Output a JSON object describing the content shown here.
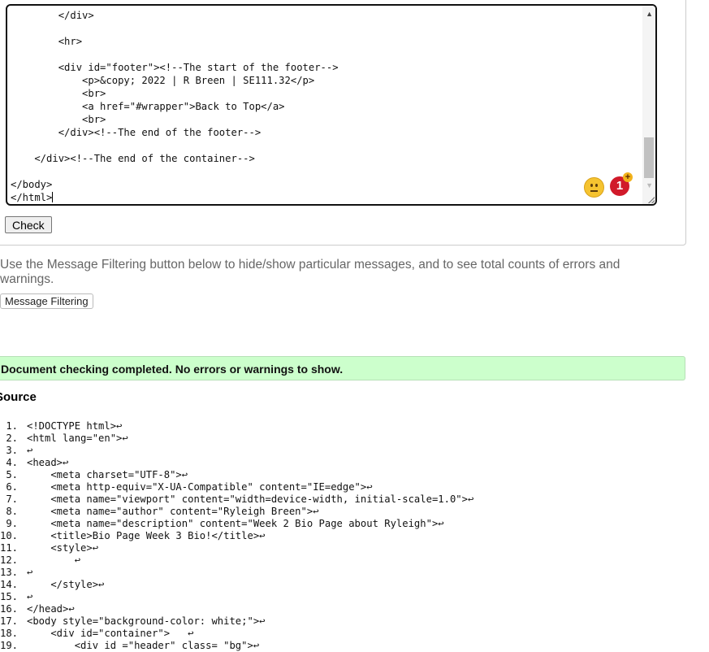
{
  "editor": {
    "lines": [
      "        </div>",
      "",
      "        <hr>",
      "",
      "        <div id=\"footer\"><!--The start of the footer-->",
      "            <p>&copy; 2022 | R Breen | SE111.32</p>",
      "            <br>",
      "            <a href=\"#wrapper\">Back to Top</a>",
      "            <br>",
      "        </div><!--The end of the footer-->",
      "",
      "    </div><!--The end of the container-->",
      "",
      "</body>",
      "</html>"
    ],
    "badge_count": "1",
    "badge_plus": "+"
  },
  "check_label": "Check",
  "help_text": "Use the Message Filtering button below to hide/show particular messages, and to see total counts of errors and warnings.",
  "filter_label": "Message Filtering",
  "success_message": "Document checking completed. No errors or warnings to show.",
  "source_heading": "Source",
  "source": {
    "lines": [
      {
        "num": "1.",
        "code": "<!DOCTYPE html>↩"
      },
      {
        "num": "2.",
        "code": "<html lang=\"en\">↩"
      },
      {
        "num": "3.",
        "code": "↩"
      },
      {
        "num": "4.",
        "code": "<head>↩"
      },
      {
        "num": "5.",
        "code": "    <meta charset=\"UTF-8\">↩"
      },
      {
        "num": "6.",
        "code": "    <meta http-equiv=\"X-UA-Compatible\" content=\"IE=edge\">↩"
      },
      {
        "num": "7.",
        "code": "    <meta name=\"viewport\" content=\"width=device-width, initial-scale=1.0\">↩"
      },
      {
        "num": "8.",
        "code": "    <meta name=\"author\" content=\"Ryleigh Breen\">↩"
      },
      {
        "num": "9.",
        "code": "    <meta name=\"description\" content=\"Week 2 Bio Page about Ryleigh\">↩"
      },
      {
        "num": "10.",
        "code": "    <title>Bio Page Week 3 Bio!</title>↩"
      },
      {
        "num": "11.",
        "code": "    <style>↩"
      },
      {
        "num": "12.",
        "code": "        ↩"
      },
      {
        "num": "13.",
        "code": "↩"
      },
      {
        "num": "14.",
        "code": "    </style>↩"
      },
      {
        "num": "15.",
        "code": "↩"
      },
      {
        "num": "16.",
        "code": "</head>↩"
      },
      {
        "num": "17.",
        "code": "<body style=\"background-color: white;\">↩"
      },
      {
        "num": "18.",
        "code": "    <div id=\"container\">   ↩"
      },
      {
        "num": "19.",
        "code": "        <div id =\"header\" class= \"bg\">↩"
      }
    ]
  }
}
